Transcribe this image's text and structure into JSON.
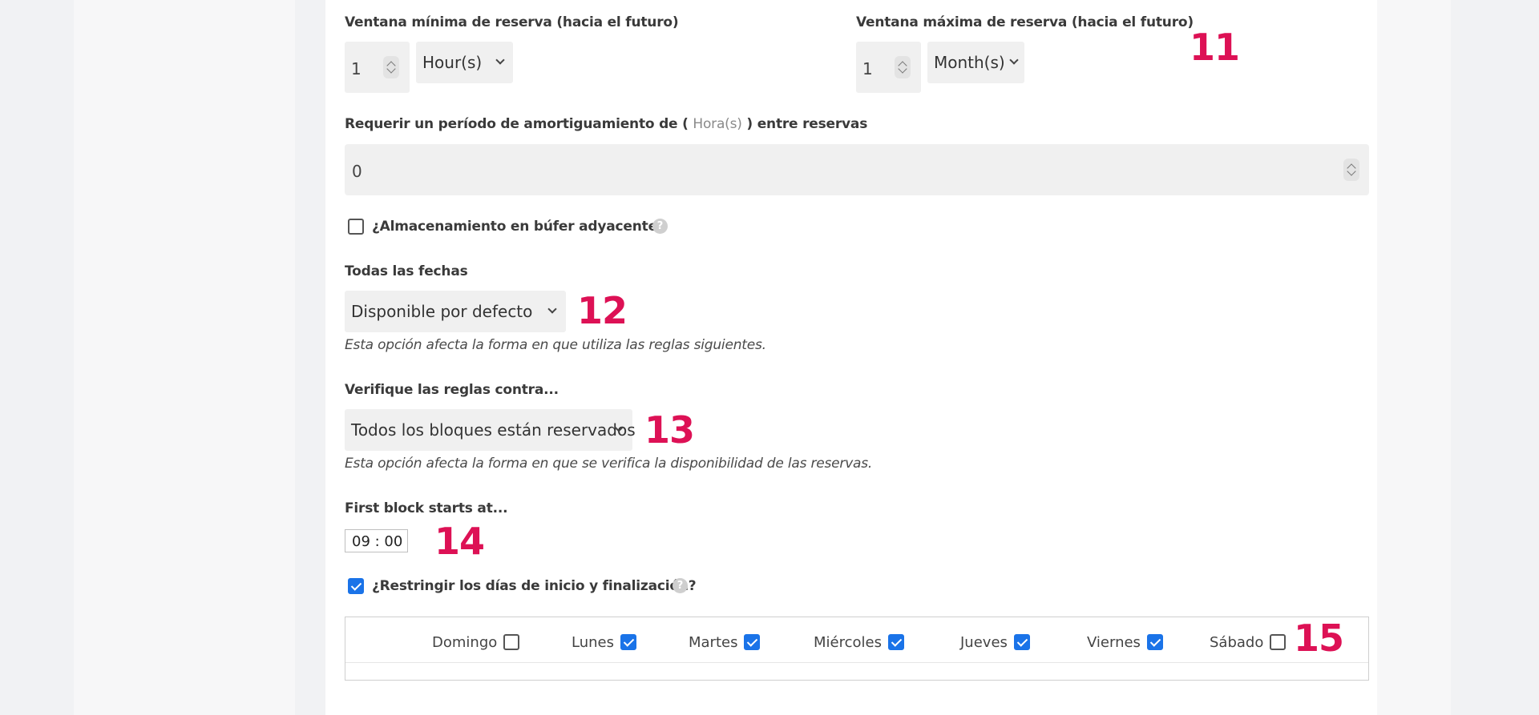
{
  "booking": {
    "min_window": {
      "label": "Ventana mínima de reserva (hacia el futuro)",
      "value": "1",
      "unit": "Hour(s)"
    },
    "max_window": {
      "label": "Ventana máxima de reserva (hacia el futuro)",
      "value": "1",
      "unit": "Month(s)"
    },
    "buffer": {
      "label_prefix": "Requerir un período de amortiguamiento de (",
      "label_unit": "Hora(s)",
      "label_suffix": ") entre reservas",
      "value": "0"
    },
    "adjacent_buffer": {
      "label": "¿Almacenamiento en búfer adyacente?",
      "checked": false
    },
    "all_dates": {
      "label": "Todas las fechas",
      "value": "Disponible por defecto",
      "note": "Esta opción afecta la forma en que utiliza las reglas siguientes."
    },
    "check_rules": {
      "label": "Verifique las reglas contra...",
      "value": "Todos los bloques están reservados",
      "note": "Esta opción afecta la forma en que se verifica la disponibilidad de las reservas."
    },
    "first_block": {
      "label": "First block starts at...",
      "value": "09 : 00"
    },
    "restrict_days": {
      "label": "¿Restringir los días de inicio y finalización?",
      "checked": true,
      "days": [
        {
          "label": "Domingo",
          "checked": false
        },
        {
          "label": "Lunes",
          "checked": true
        },
        {
          "label": "Martes",
          "checked": true
        },
        {
          "label": "Miércoles",
          "checked": true
        },
        {
          "label": "Jueves",
          "checked": true
        },
        {
          "label": "Viernes",
          "checked": true
        },
        {
          "label": "Sábado",
          "checked": false
        }
      ]
    }
  },
  "markers": [
    "11",
    "12",
    "13",
    "14",
    "15"
  ],
  "help_glyph": "?",
  "colors": {
    "marker": "#dd1155",
    "checkbox_checked": "#1a73e8"
  }
}
